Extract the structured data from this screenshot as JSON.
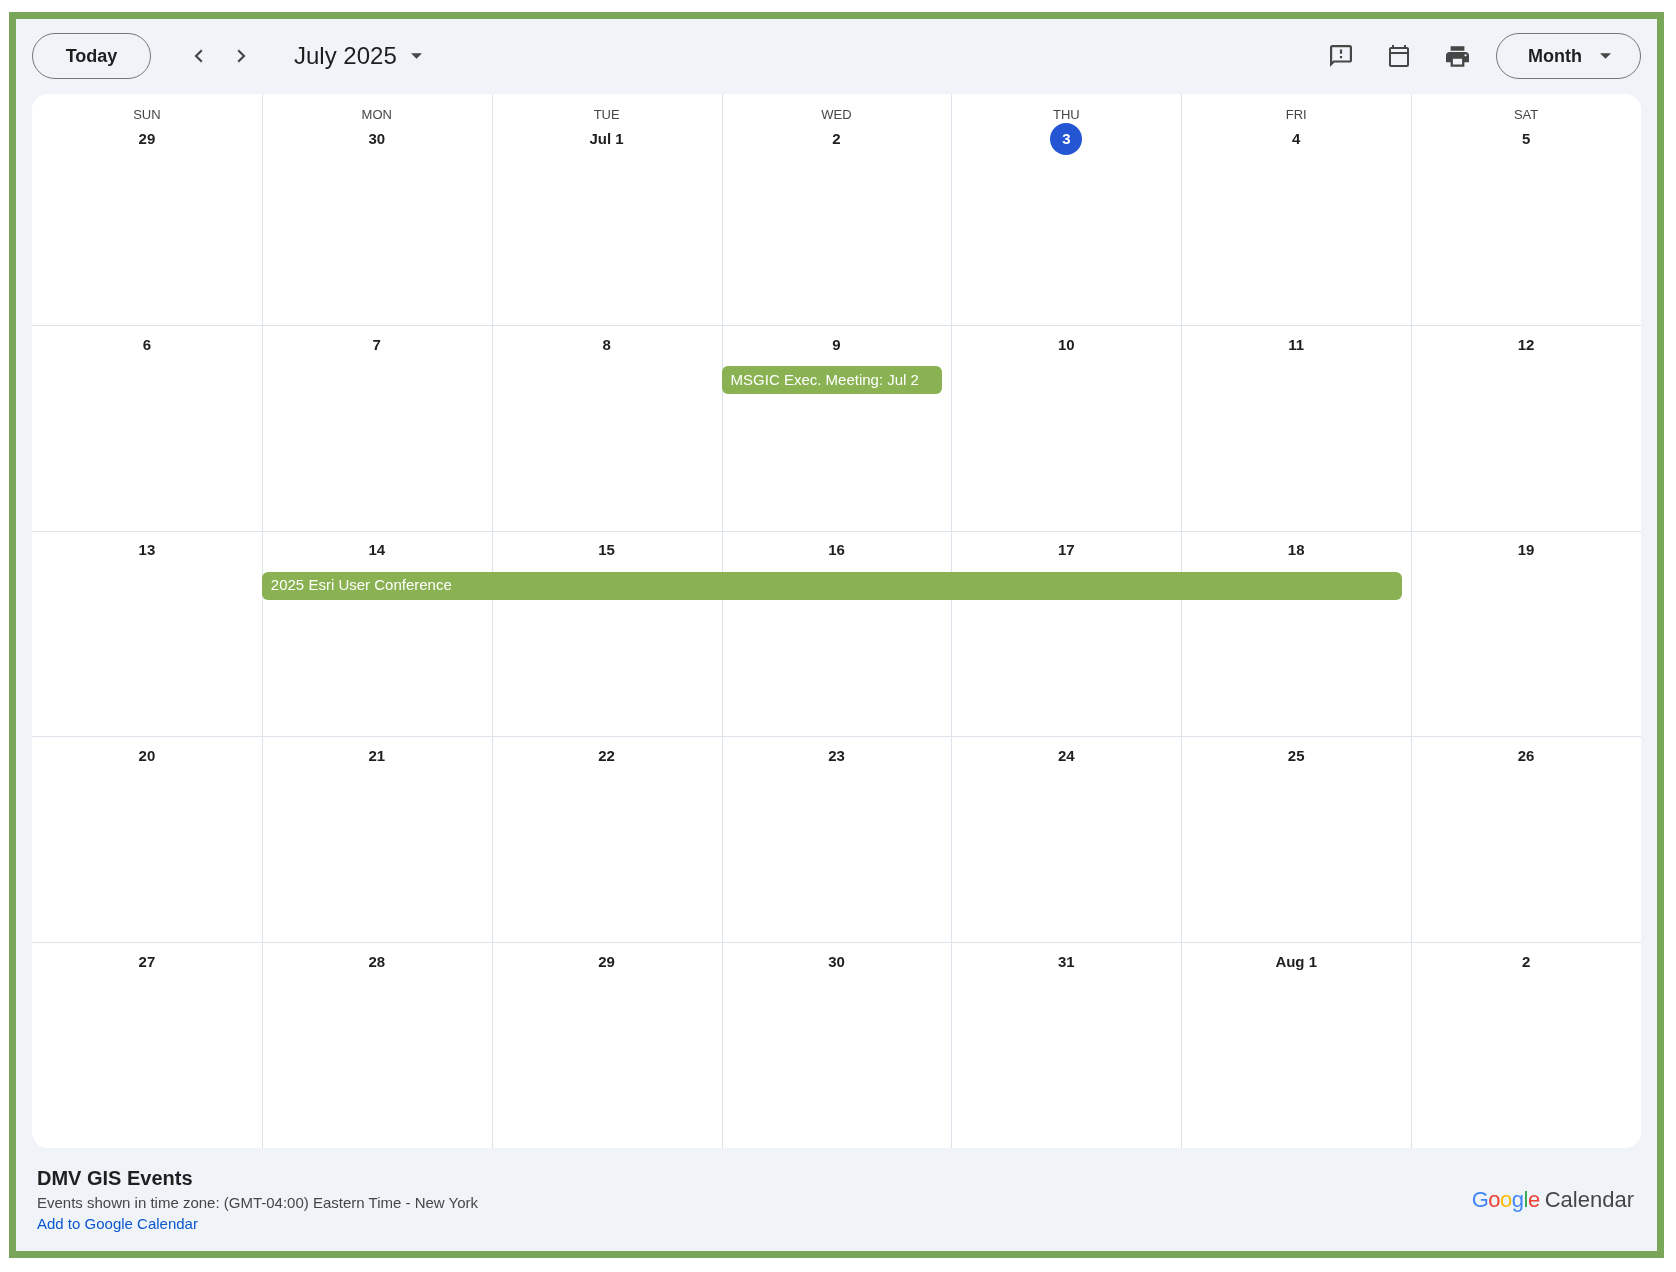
{
  "toolbar": {
    "today_button": "Today",
    "title": "July 2025",
    "view_button": "Month"
  },
  "calendar": {
    "weekdays": [
      "SUN",
      "MON",
      "TUE",
      "WED",
      "THU",
      "FRI",
      "SAT"
    ],
    "weeks": [
      {
        "days": [
          {
            "label": "29",
            "today": false
          },
          {
            "label": "30",
            "today": false
          },
          {
            "label": "Jul 1",
            "today": false
          },
          {
            "label": "2",
            "today": false
          },
          {
            "label": "3",
            "today": true
          },
          {
            "label": "4",
            "today": false
          },
          {
            "label": "5",
            "today": false
          }
        ]
      },
      {
        "days": [
          {
            "label": "6",
            "today": false
          },
          {
            "label": "7",
            "today": false
          },
          {
            "label": "8",
            "today": false
          },
          {
            "label": "9",
            "today": false
          },
          {
            "label": "10",
            "today": false
          },
          {
            "label": "11",
            "today": false
          },
          {
            "label": "12",
            "today": false
          }
        ],
        "events": [
          {
            "title": "MSGIC Exec. Meeting: Jul 2",
            "on_days": [
              false,
              false,
              false,
              true,
              false,
              false,
              false
            ]
          }
        ]
      },
      {
        "days": [
          {
            "label": "13",
            "today": false
          },
          {
            "label": "14",
            "today": false
          },
          {
            "label": "15",
            "today": false
          },
          {
            "label": "16",
            "today": false
          },
          {
            "label": "17",
            "today": false
          },
          {
            "label": "18",
            "today": false
          },
          {
            "label": "19",
            "today": false
          }
        ],
        "events": [
          {
            "title": "2025 Esri User Conference",
            "on_days": [
              false,
              true,
              true,
              true,
              true,
              true,
              false
            ]
          }
        ]
      },
      {
        "days": [
          {
            "label": "20",
            "today": false
          },
          {
            "label": "21",
            "today": false
          },
          {
            "label": "22",
            "today": false
          },
          {
            "label": "23",
            "today": false
          },
          {
            "label": "24",
            "today": false
          },
          {
            "label": "25",
            "today": false
          },
          {
            "label": "26",
            "today": false
          }
        ]
      },
      {
        "days": [
          {
            "label": "27",
            "today": false
          },
          {
            "label": "28",
            "today": false
          },
          {
            "label": "29",
            "today": false
          },
          {
            "label": "30",
            "today": false
          },
          {
            "label": "31",
            "today": false
          },
          {
            "label": "Aug 1",
            "today": false
          },
          {
            "label": "2",
            "today": false
          }
        ]
      }
    ]
  },
  "footer": {
    "title": "DMV GIS Events",
    "timezone_note": "Events shown in time zone: (GMT-04:00) Eastern Time - New York",
    "add_link": "Add to Google Calendar",
    "logo": {
      "brand": "Google",
      "product": "Calendar"
    }
  }
}
